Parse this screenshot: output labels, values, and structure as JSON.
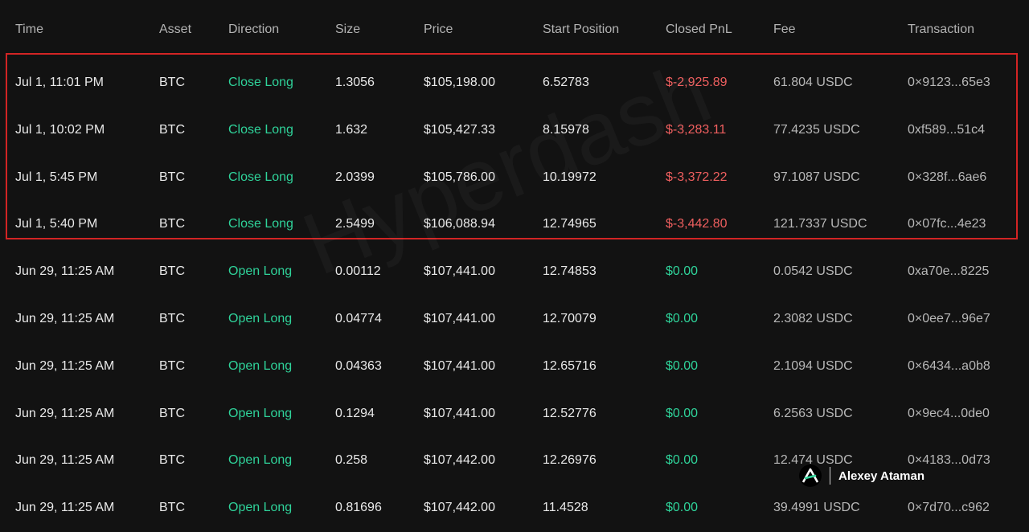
{
  "table": {
    "headers": {
      "time": "Time",
      "asset": "Asset",
      "direction": "Direction",
      "size": "Size",
      "price": "Price",
      "start_position": "Start Position",
      "closed_pnl": "Closed PnL",
      "fee": "Fee",
      "transaction": "Transaction"
    },
    "rows": [
      {
        "time": "Jul 1, 11:01 PM",
        "asset": "BTC",
        "direction": "Close Long",
        "size": "1.3056",
        "price": "$105,198.00",
        "start_position": "6.52783",
        "closed_pnl": "$-2,925.89",
        "fee": "61.804 USDC",
        "transaction": "0×9123...65e3"
      },
      {
        "time": "Jul 1, 10:02 PM",
        "asset": "BTC",
        "direction": "Close Long",
        "size": "1.632",
        "price": "$105,427.33",
        "start_position": "8.15978",
        "closed_pnl": "$-3,283.11",
        "fee": "77.4235 USDC",
        "transaction": "0xf589...51c4"
      },
      {
        "time": "Jul 1, 5:45 PM",
        "asset": "BTC",
        "direction": "Close Long",
        "size": "2.0399",
        "price": "$105,786.00",
        "start_position": "10.19972",
        "closed_pnl": "$-3,372.22",
        "fee": "97.1087 USDC",
        "transaction": "0×328f...6ae6"
      },
      {
        "time": "Jul 1, 5:40 PM",
        "asset": "BTC",
        "direction": "Close Long",
        "size": "2.5499",
        "price": "$106,088.94",
        "start_position": "12.74965",
        "closed_pnl": "$-3,442.80",
        "fee": "121.7337 USDC",
        "transaction": "0×07fc...4e23"
      },
      {
        "time": "Jun 29, 11:25 AM",
        "asset": "BTC",
        "direction": "Open Long",
        "size": "0.00112",
        "price": "$107,441.00",
        "start_position": "12.74853",
        "closed_pnl": "$0.00",
        "fee": "0.0542 USDC",
        "transaction": "0xa70e...8225"
      },
      {
        "time": "Jun 29, 11:25 AM",
        "asset": "BTC",
        "direction": "Open Long",
        "size": "0.04774",
        "price": "$107,441.00",
        "start_position": "12.70079",
        "closed_pnl": "$0.00",
        "fee": "2.3082 USDC",
        "transaction": "0×0ee7...96e7"
      },
      {
        "time": "Jun 29, 11:25 AM",
        "asset": "BTC",
        "direction": "Open Long",
        "size": "0.04363",
        "price": "$107,441.00",
        "start_position": "12.65716",
        "closed_pnl": "$0.00",
        "fee": "2.1094 USDC",
        "transaction": "0×6434...a0b8"
      },
      {
        "time": "Jun 29, 11:25 AM",
        "asset": "BTC",
        "direction": "Open Long",
        "size": "0.1294",
        "price": "$107,441.00",
        "start_position": "12.52776",
        "closed_pnl": "$0.00",
        "fee": "6.2563 USDC",
        "transaction": "0×9ec4...0de0"
      },
      {
        "time": "Jun 29, 11:25 AM",
        "asset": "BTC",
        "direction": "Open Long",
        "size": "0.258",
        "price": "$107,442.00",
        "start_position": "12.26976",
        "closed_pnl": "$0.00",
        "fee": "12.474 USDC",
        "transaction": "0×4183...0d73"
      },
      {
        "time": "Jun 29, 11:25 AM",
        "asset": "BTC",
        "direction": "Open Long",
        "size": "0.81696",
        "price": "$107,442.00",
        "start_position": "11.4528",
        "closed_pnl": "$0.00",
        "fee": "39.4991 USDC",
        "transaction": "0×7d70...c962"
      }
    ]
  },
  "watermark": {
    "text": "Hyperdash"
  },
  "author_badge": {
    "name": "Alexey Ataman",
    "logo_icon": "stylized-a-logo-icon"
  },
  "colors": {
    "background": "#121212",
    "positive_green": "#2fd39a",
    "negative_red": "#ef5f5f",
    "highlight_border": "#d22424",
    "header_text": "#b3b3b3"
  }
}
